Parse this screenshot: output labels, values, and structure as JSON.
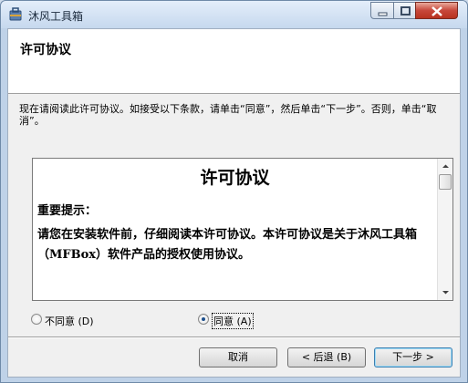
{
  "window": {
    "title": "沐风工具箱"
  },
  "header": {
    "title": "许可协议"
  },
  "instructions": "现在请阅读此许可协议。如接受以下条款，请单击“同意”，然后单击“下一步”。否则，单击“取消”。",
  "license": {
    "title": "许可协议",
    "notice": "重要提示：",
    "body": "请您在安装软件前，仔细阅读本许可协议。本许可协议是关于沐风工具箱（MFBox）软件产品的授权使用协议。"
  },
  "options": {
    "disagree_label": "不同意 (D)",
    "agree_label": "同意 (A)",
    "selected": "agree"
  },
  "buttons": {
    "cancel": "取消",
    "back": "< 后退 (B)",
    "next": "下一步 >"
  },
  "colors": {
    "title_bar": "#c6d8ee",
    "close_button": "#c7473a",
    "default_button_border": "#3c7fb1"
  },
  "icons": {
    "app": "toolbox-icon",
    "minimize": "minimize-icon",
    "maximize": "maximize-icon",
    "close": "close-icon"
  }
}
